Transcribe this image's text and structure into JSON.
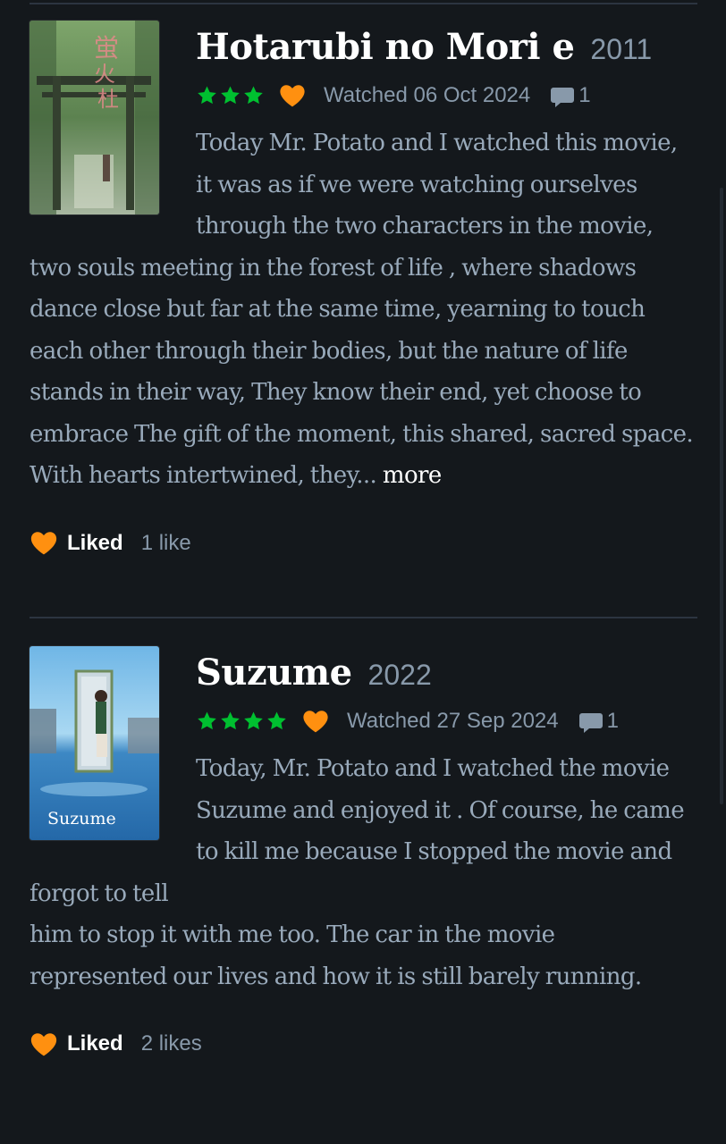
{
  "colors": {
    "background": "#14181c",
    "star_green": "#00c030",
    "heart_orange": "#ff9010",
    "muted_text": "#8899aa",
    "body_text": "#99aabb",
    "title_text": "#ffffff",
    "divider": "#2c3440"
  },
  "reviews": [
    {
      "title": "Hotarubi no Mori e",
      "year": "2011",
      "rating_stars": 3,
      "liked": true,
      "watched": "Watched 06 Oct 2024",
      "comments": "1",
      "body_lines": "Today Mr. Potato and I watched this movie, it was as if we were watching ourselves through the two characters in the movie, two souls meeting in the forest of life , where shadows dance close but far at the same time, yearning to touch each other through their bodies, but the nature of life stands in their way, They know their end, yet choose to embrace The gift of the moment, this shared, sacred space. With hearts intertwined, they...",
      "more_label": "more",
      "liked_label": "Liked",
      "likes": "1 like",
      "poster_icon": "forest-torii-poster"
    },
    {
      "title": "Suzume",
      "year": "2022",
      "rating_stars": 4,
      "liked": true,
      "watched": "Watched 27 Sep 2024",
      "comments": "1",
      "body_para1": "Today, Mr. Potato and I watched the movie Suzume and enjoyed it . Of course, he came to kill me because I stopped the movie and forgot to tell",
      "body_para2": "him to stop it with me too. The car in the movie represented our lives and how it is still barely running.",
      "liked_label": "Liked",
      "likes": "2 likes",
      "poster_text": "Suzume",
      "poster_icon": "door-in-water-poster"
    }
  ]
}
